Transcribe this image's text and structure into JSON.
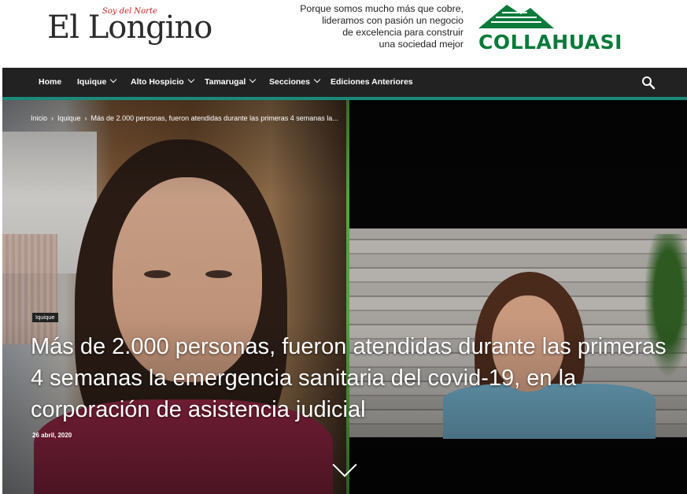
{
  "header": {
    "logo_text": "El Longino",
    "logo_tagline": "Soy del Norte",
    "ad": {
      "lines": [
        "Porque somos mucho más que cobre,",
        "lideramos con pasión un negocio",
        "de excelencia para construir",
        "una sociedad mejor"
      ],
      "brand": "COLLAHUASI",
      "brand_color": "#0b7a3a"
    }
  },
  "nav": {
    "items": [
      {
        "label": "Home",
        "dropdown": false
      },
      {
        "label": "Iquique",
        "dropdown": true
      },
      {
        "label": "Alto Hospicio",
        "dropdown": true
      },
      {
        "label": "Tamarugal",
        "dropdown": true
      },
      {
        "label": "Secciones",
        "dropdown": true
      },
      {
        "label": "Ediciones Anteriores",
        "dropdown": false
      }
    ],
    "search_icon": "search-icon",
    "accent_color": "#1a8a7a"
  },
  "article": {
    "breadcrumb": [
      "Inicio",
      "Iquique",
      "Más de 2.000 personas, fueron atendidas durante las primeras 4 semanas la..."
    ],
    "category": "Iquique",
    "title": "Más de 2.000 personas, fueron atendidas durante las primeras 4 semanas la emergencia sanitaria del covid-19, en la corporación de asistencia judicial",
    "date": "26 abril, 2020"
  }
}
